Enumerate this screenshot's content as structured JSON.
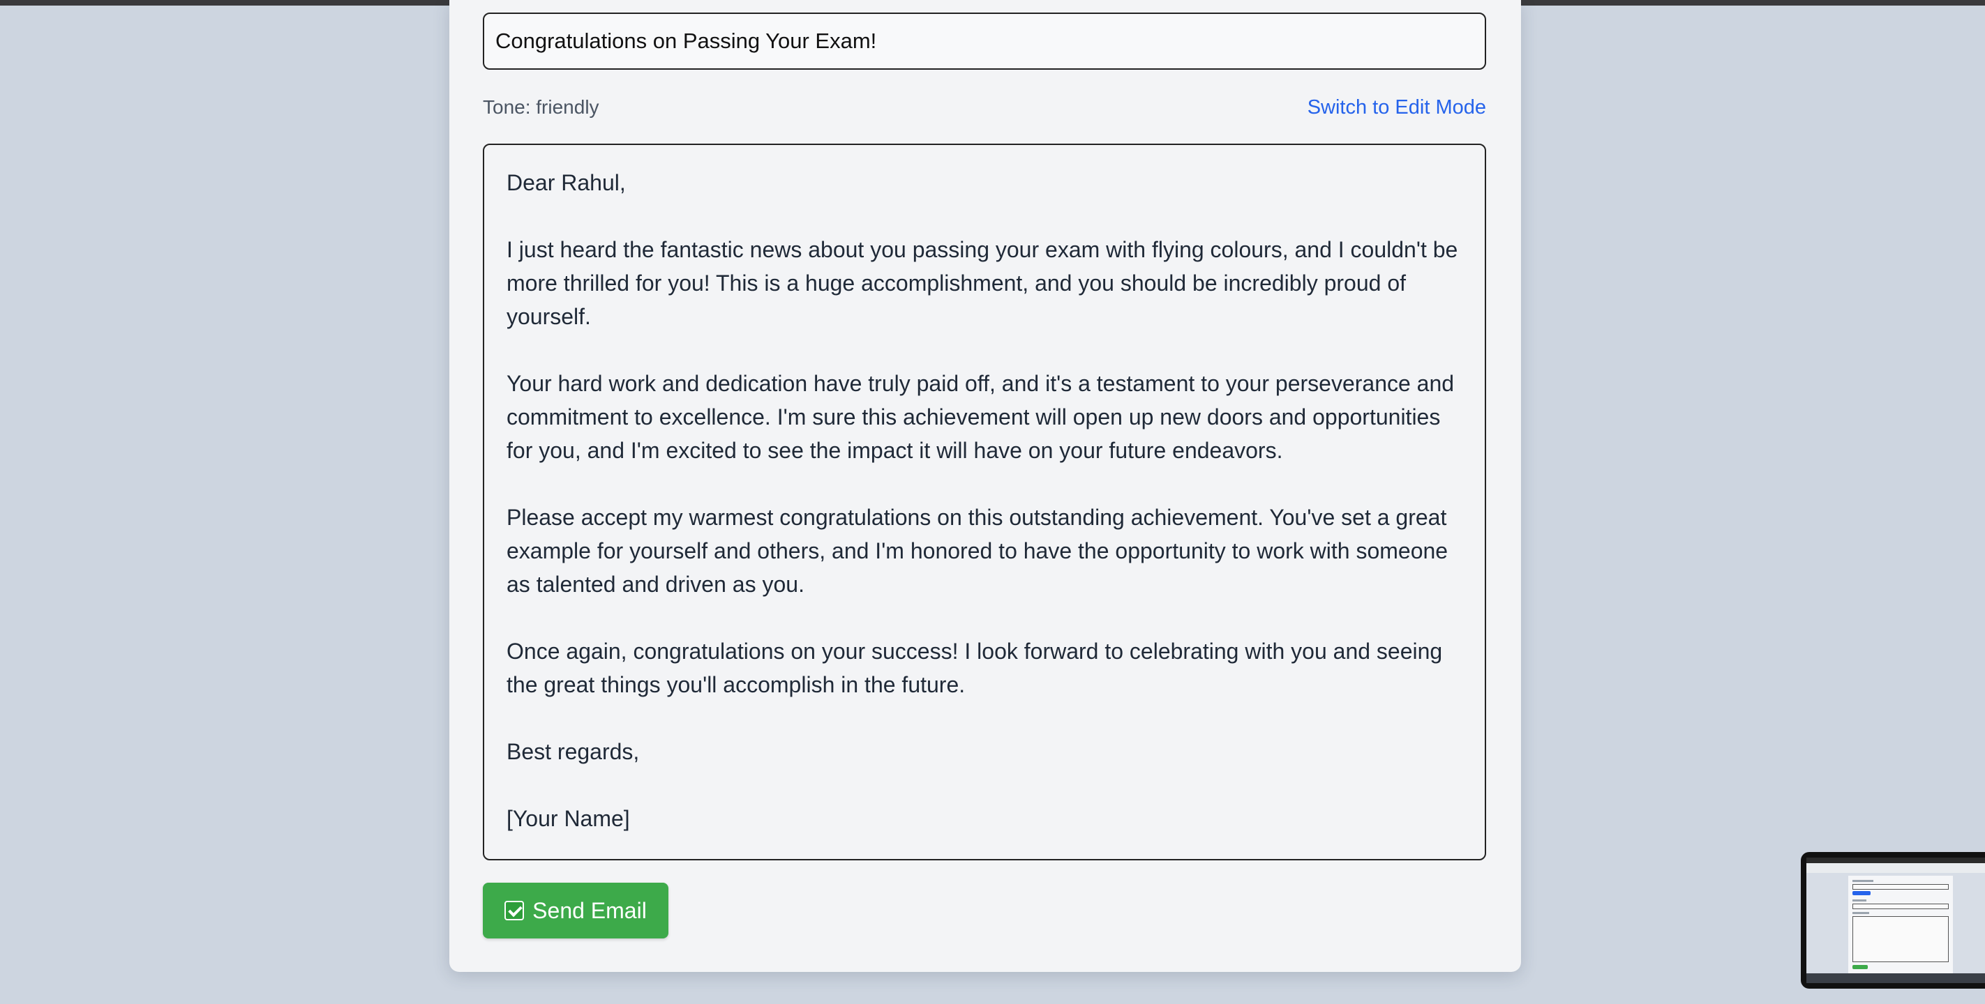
{
  "email": {
    "subject_value": "Congratulations on Passing Your Exam!",
    "tone_label": "Tone: friendly",
    "switch_mode_label": "Switch to Edit Mode",
    "body": [
      "Dear Rahul,",
      "I just heard the fantastic news about you passing your exam with flying colours, and I couldn't be more thrilled for you! This is a huge accomplishment, and you should be incredibly proud of yourself.",
      "Your hard work and dedication have truly paid off, and it's a testament to your perseverance and commitment to excellence. I'm sure this achievement will open up new doors and opportunities for you, and I'm excited to see the impact it will have on your future endeavors.",
      "Please accept my warmest congratulations on this outstanding achievement. You've set a great example for yourself and others, and I'm honored to have the opportunity to work with someone as talented and driven as you.",
      "Once again, congratulations on your success! I look forward to celebrating with you and seeing the great things you'll accomplish in the future.",
      "Best regards,",
      "[Your Name]"
    ],
    "send_label": "Send Email"
  },
  "icons": {
    "send_button_icon": "check-box-icon"
  },
  "colors": {
    "page_background": "#cdd5e0",
    "card_background": "#f3f4f6",
    "link_blue": "#2563eb",
    "send_green": "#3daa4a"
  }
}
